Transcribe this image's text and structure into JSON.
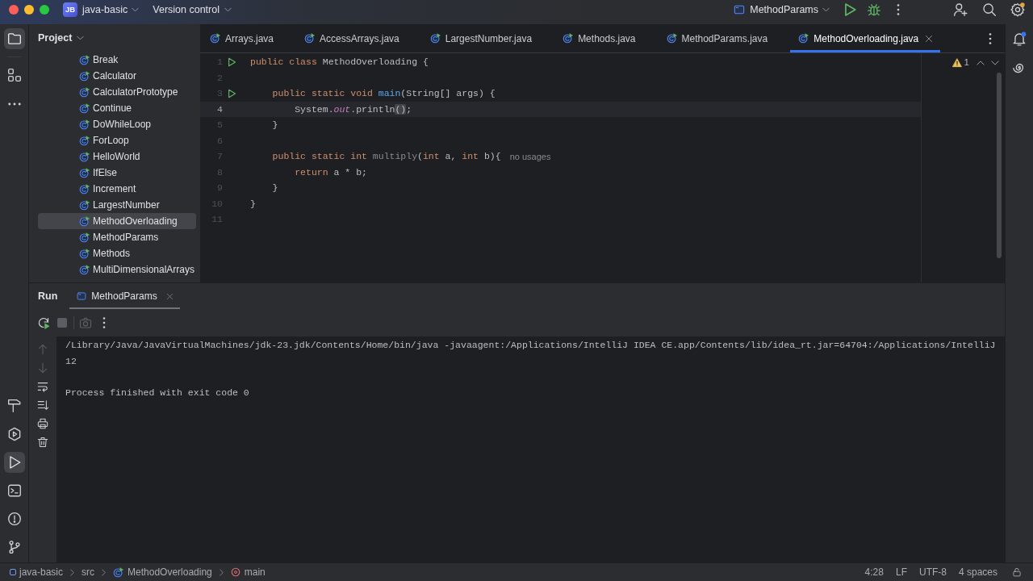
{
  "title_bar": {
    "badge": "JB",
    "project": "java-basic",
    "vcs": "Version control",
    "run_config": "MethodParams"
  },
  "tool_strip": {
    "top": [
      {
        "kind": "project",
        "selected": true
      },
      {
        "kind": "structure",
        "selected": false
      },
      {
        "kind": "more",
        "selected": false
      }
    ],
    "bottom": [
      {
        "kind": "build",
        "selected": false
      },
      {
        "kind": "services",
        "selected": false
      },
      {
        "kind": "run",
        "selected": true
      },
      {
        "kind": "terminal",
        "selected": false
      },
      {
        "kind": "problems",
        "selected": false
      },
      {
        "kind": "git",
        "selected": false
      }
    ]
  },
  "project_panel": {
    "title": "Project",
    "items": [
      {
        "label": "Break",
        "selected": false
      },
      {
        "label": "Calculator",
        "selected": false
      },
      {
        "label": "CalculatorPrototype",
        "selected": false
      },
      {
        "label": "Continue",
        "selected": false
      },
      {
        "label": "DoWhileLoop",
        "selected": false
      },
      {
        "label": "ForLoop",
        "selected": false
      },
      {
        "label": "HelloWorld",
        "selected": false
      },
      {
        "label": "IfElse",
        "selected": false
      },
      {
        "label": "Increment",
        "selected": false
      },
      {
        "label": "LargestNumber",
        "selected": false
      },
      {
        "label": "MethodOverloading",
        "selected": true
      },
      {
        "label": "MethodParams",
        "selected": false
      },
      {
        "label": "Methods",
        "selected": false
      },
      {
        "label": "MultiDimensionalArrays",
        "selected": false
      }
    ]
  },
  "editor": {
    "tabs": [
      {
        "label": "Arrays.java",
        "selected": false
      },
      {
        "label": "AccessArrays.java",
        "selected": false
      },
      {
        "label": "LargestNumber.java",
        "selected": false
      },
      {
        "label": "Methods.java",
        "selected": false
      },
      {
        "label": "MethodParams.java",
        "selected": false
      },
      {
        "label": "MethodOverloading.java",
        "selected": true
      }
    ],
    "lines": [
      {
        "number": "1",
        "runnable": true,
        "current": false,
        "tokens": [
          {
            "kind": "keyword",
            "text": "public class"
          },
          {
            "kind": "plain",
            "text": " MethodOverloading {"
          }
        ]
      },
      {
        "number": "2",
        "runnable": false,
        "current": false
      },
      {
        "number": "3",
        "runnable": true,
        "current": false,
        "tokens": [
          {
            "kind": "keyword",
            "text": "    public static void "
          },
          {
            "kind": "method",
            "text": "main"
          },
          {
            "kind": "plain",
            "text": "(String[] args) {"
          }
        ]
      },
      {
        "number": "4",
        "runnable": false,
        "current": true,
        "tokens": [
          {
            "kind": "plain",
            "text": "        System."
          },
          {
            "kind": "static_field",
            "text": "out"
          },
          {
            "kind": "plain",
            "text": ".println"
          },
          {
            "kind": "brace_match",
            "text": "()"
          },
          {
            "kind": "plain",
            "text": ";"
          }
        ]
      },
      {
        "number": "5",
        "runnable": false,
        "current": false,
        "tokens": [
          {
            "kind": "plain",
            "text": "    }"
          }
        ]
      },
      {
        "number": "6",
        "runnable": false,
        "current": false
      },
      {
        "number": "7",
        "runnable": false,
        "current": false,
        "tokens": [
          {
            "kind": "keyword",
            "text": "    public static int "
          },
          {
            "kind": "unused",
            "text": "multiply"
          },
          {
            "kind": "plain",
            "text": "("
          },
          {
            "kind": "keyword",
            "text": "int"
          },
          {
            "kind": "plain",
            "text": " a, "
          },
          {
            "kind": "keyword",
            "text": "int"
          },
          {
            "kind": "plain",
            "text": " b){"
          }
        ],
        "hint": "no usages"
      },
      {
        "number": "8",
        "runnable": false,
        "current": false,
        "tokens": [
          {
            "kind": "keyword",
            "text": "        return"
          },
          {
            "kind": "plain",
            "text": " a * b;"
          }
        ]
      },
      {
        "number": "9",
        "runnable": false,
        "current": false,
        "tokens": [
          {
            "kind": "plain",
            "text": "    }"
          }
        ]
      },
      {
        "number": "10",
        "runnable": false,
        "current": false,
        "tokens": [
          {
            "kind": "plain",
            "text": "}"
          }
        ]
      },
      {
        "number": "11",
        "runnable": false,
        "current": false
      }
    ],
    "warnings": "1"
  },
  "run_panel": {
    "title": "Run",
    "tabs": [
      {
        "label": "MethodParams",
        "selected": true
      }
    ],
    "toolbar": [
      {
        "kind": "rerun",
        "disabled": false
      },
      {
        "kind": "stop",
        "disabled": true
      },
      {
        "kind": "screenshot",
        "disabled": true
      },
      {
        "kind": "more",
        "disabled": false
      }
    ],
    "side_tools": [
      {
        "kind": "up",
        "disabled": true
      },
      {
        "kind": "down",
        "disabled": true
      },
      {
        "kind": "wrap",
        "disabled": false
      },
      {
        "kind": "scroll-end",
        "disabled": false
      },
      {
        "kind": "print",
        "disabled": false
      },
      {
        "kind": "clear",
        "disabled": false
      }
    ],
    "console": [
      {
        "kind": "command",
        "text": "/Library/Java/JavaVirtualMachines/jdk-23.jdk/Contents/Home/bin/java -javaagent:/Applications/IntelliJ IDEA CE.app/Contents/lib/idea_rt.jar=64704:/Applications/IntelliJ"
      },
      {
        "kind": "output",
        "text": "12"
      },
      {
        "kind": "status",
        "text": "Process finished with exit code 0"
      }
    ]
  },
  "status_bar": {
    "breadcrumbs": [
      {
        "kind": "module",
        "label": "java-basic"
      },
      {
        "kind": "folder",
        "label": "src"
      },
      {
        "kind": "class",
        "label": "MethodOverloading"
      },
      {
        "kind": "method",
        "label": "main"
      }
    ],
    "widgets": [
      "4:28",
      "LF",
      "UTF-8",
      "4 spaces"
    ]
  }
}
